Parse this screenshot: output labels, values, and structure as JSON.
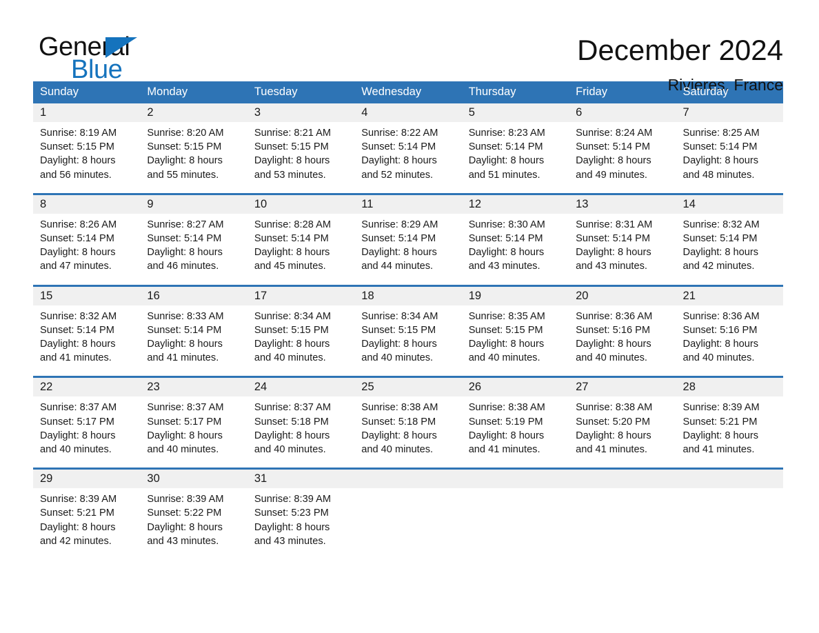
{
  "brand": {
    "name_part1": "General",
    "name_part2": "Blue",
    "triangle_color": "#1573bd",
    "icon": "triangle-right-icon"
  },
  "header": {
    "title": "December 2024",
    "subtitle": "Rivieres, France"
  },
  "theme": {
    "header_blue": "#2e74b5",
    "daynum_band": "#f0f0f0",
    "text": "#1a1a1a",
    "brand_blue": "#1573bd"
  },
  "weekday_headers": [
    "Sunday",
    "Monday",
    "Tuesday",
    "Wednesday",
    "Thursday",
    "Friday",
    "Saturday"
  ],
  "weeks": [
    {
      "days": [
        {
          "date": "1",
          "sunrise": "Sunrise: 8:19 AM",
          "sunset": "Sunset: 5:15 PM",
          "daylight_1": "Daylight: 8 hours",
          "daylight_2": "and 56 minutes."
        },
        {
          "date": "2",
          "sunrise": "Sunrise: 8:20 AM",
          "sunset": "Sunset: 5:15 PM",
          "daylight_1": "Daylight: 8 hours",
          "daylight_2": "and 55 minutes."
        },
        {
          "date": "3",
          "sunrise": "Sunrise: 8:21 AM",
          "sunset": "Sunset: 5:15 PM",
          "daylight_1": "Daylight: 8 hours",
          "daylight_2": "and 53 minutes."
        },
        {
          "date": "4",
          "sunrise": "Sunrise: 8:22 AM",
          "sunset": "Sunset: 5:14 PM",
          "daylight_1": "Daylight: 8 hours",
          "daylight_2": "and 52 minutes."
        },
        {
          "date": "5",
          "sunrise": "Sunrise: 8:23 AM",
          "sunset": "Sunset: 5:14 PM",
          "daylight_1": "Daylight: 8 hours",
          "daylight_2": "and 51 minutes."
        },
        {
          "date": "6",
          "sunrise": "Sunrise: 8:24 AM",
          "sunset": "Sunset: 5:14 PM",
          "daylight_1": "Daylight: 8 hours",
          "daylight_2": "and 49 minutes."
        },
        {
          "date": "7",
          "sunrise": "Sunrise: 8:25 AM",
          "sunset": "Sunset: 5:14 PM",
          "daylight_1": "Daylight: 8 hours",
          "daylight_2": "and 48 minutes."
        }
      ]
    },
    {
      "days": [
        {
          "date": "8",
          "sunrise": "Sunrise: 8:26 AM",
          "sunset": "Sunset: 5:14 PM",
          "daylight_1": "Daylight: 8 hours",
          "daylight_2": "and 47 minutes."
        },
        {
          "date": "9",
          "sunrise": "Sunrise: 8:27 AM",
          "sunset": "Sunset: 5:14 PM",
          "daylight_1": "Daylight: 8 hours",
          "daylight_2": "and 46 minutes."
        },
        {
          "date": "10",
          "sunrise": "Sunrise: 8:28 AM",
          "sunset": "Sunset: 5:14 PM",
          "daylight_1": "Daylight: 8 hours",
          "daylight_2": "and 45 minutes."
        },
        {
          "date": "11",
          "sunrise": "Sunrise: 8:29 AM",
          "sunset": "Sunset: 5:14 PM",
          "daylight_1": "Daylight: 8 hours",
          "daylight_2": "and 44 minutes."
        },
        {
          "date": "12",
          "sunrise": "Sunrise: 8:30 AM",
          "sunset": "Sunset: 5:14 PM",
          "daylight_1": "Daylight: 8 hours",
          "daylight_2": "and 43 minutes."
        },
        {
          "date": "13",
          "sunrise": "Sunrise: 8:31 AM",
          "sunset": "Sunset: 5:14 PM",
          "daylight_1": "Daylight: 8 hours",
          "daylight_2": "and 43 minutes."
        },
        {
          "date": "14",
          "sunrise": "Sunrise: 8:32 AM",
          "sunset": "Sunset: 5:14 PM",
          "daylight_1": "Daylight: 8 hours",
          "daylight_2": "and 42 minutes."
        }
      ]
    },
    {
      "days": [
        {
          "date": "15",
          "sunrise": "Sunrise: 8:32 AM",
          "sunset": "Sunset: 5:14 PM",
          "daylight_1": "Daylight: 8 hours",
          "daylight_2": "and 41 minutes."
        },
        {
          "date": "16",
          "sunrise": "Sunrise: 8:33 AM",
          "sunset": "Sunset: 5:14 PM",
          "daylight_1": "Daylight: 8 hours",
          "daylight_2": "and 41 minutes."
        },
        {
          "date": "17",
          "sunrise": "Sunrise: 8:34 AM",
          "sunset": "Sunset: 5:15 PM",
          "daylight_1": "Daylight: 8 hours",
          "daylight_2": "and 40 minutes."
        },
        {
          "date": "18",
          "sunrise": "Sunrise: 8:34 AM",
          "sunset": "Sunset: 5:15 PM",
          "daylight_1": "Daylight: 8 hours",
          "daylight_2": "and 40 minutes."
        },
        {
          "date": "19",
          "sunrise": "Sunrise: 8:35 AM",
          "sunset": "Sunset: 5:15 PM",
          "daylight_1": "Daylight: 8 hours",
          "daylight_2": "and 40 minutes."
        },
        {
          "date": "20",
          "sunrise": "Sunrise: 8:36 AM",
          "sunset": "Sunset: 5:16 PM",
          "daylight_1": "Daylight: 8 hours",
          "daylight_2": "and 40 minutes."
        },
        {
          "date": "21",
          "sunrise": "Sunrise: 8:36 AM",
          "sunset": "Sunset: 5:16 PM",
          "daylight_1": "Daylight: 8 hours",
          "daylight_2": "and 40 minutes."
        }
      ]
    },
    {
      "days": [
        {
          "date": "22",
          "sunrise": "Sunrise: 8:37 AM",
          "sunset": "Sunset: 5:17 PM",
          "daylight_1": "Daylight: 8 hours",
          "daylight_2": "and 40 minutes."
        },
        {
          "date": "23",
          "sunrise": "Sunrise: 8:37 AM",
          "sunset": "Sunset: 5:17 PM",
          "daylight_1": "Daylight: 8 hours",
          "daylight_2": "and 40 minutes."
        },
        {
          "date": "24",
          "sunrise": "Sunrise: 8:37 AM",
          "sunset": "Sunset: 5:18 PM",
          "daylight_1": "Daylight: 8 hours",
          "daylight_2": "and 40 minutes."
        },
        {
          "date": "25",
          "sunrise": "Sunrise: 8:38 AM",
          "sunset": "Sunset: 5:18 PM",
          "daylight_1": "Daylight: 8 hours",
          "daylight_2": "and 40 minutes."
        },
        {
          "date": "26",
          "sunrise": "Sunrise: 8:38 AM",
          "sunset": "Sunset: 5:19 PM",
          "daylight_1": "Daylight: 8 hours",
          "daylight_2": "and 41 minutes."
        },
        {
          "date": "27",
          "sunrise": "Sunrise: 8:38 AM",
          "sunset": "Sunset: 5:20 PM",
          "daylight_1": "Daylight: 8 hours",
          "daylight_2": "and 41 minutes."
        },
        {
          "date": "28",
          "sunrise": "Sunrise: 8:39 AM",
          "sunset": "Sunset: 5:21 PM",
          "daylight_1": "Daylight: 8 hours",
          "daylight_2": "and 41 minutes."
        }
      ]
    },
    {
      "days": [
        {
          "date": "29",
          "sunrise": "Sunrise: 8:39 AM",
          "sunset": "Sunset: 5:21 PM",
          "daylight_1": "Daylight: 8 hours",
          "daylight_2": "and 42 minutes."
        },
        {
          "date": "30",
          "sunrise": "Sunrise: 8:39 AM",
          "sunset": "Sunset: 5:22 PM",
          "daylight_1": "Daylight: 8 hours",
          "daylight_2": "and 43 minutes."
        },
        {
          "date": "31",
          "sunrise": "Sunrise: 8:39 AM",
          "sunset": "Sunset: 5:23 PM",
          "daylight_1": "Daylight: 8 hours",
          "daylight_2": "and 43 minutes."
        },
        {
          "date": "",
          "sunrise": "",
          "sunset": "",
          "daylight_1": "",
          "daylight_2": ""
        },
        {
          "date": "",
          "sunrise": "",
          "sunset": "",
          "daylight_1": "",
          "daylight_2": ""
        },
        {
          "date": "",
          "sunrise": "",
          "sunset": "",
          "daylight_1": "",
          "daylight_2": ""
        },
        {
          "date": "",
          "sunrise": "",
          "sunset": "",
          "daylight_1": "",
          "daylight_2": ""
        }
      ]
    }
  ]
}
